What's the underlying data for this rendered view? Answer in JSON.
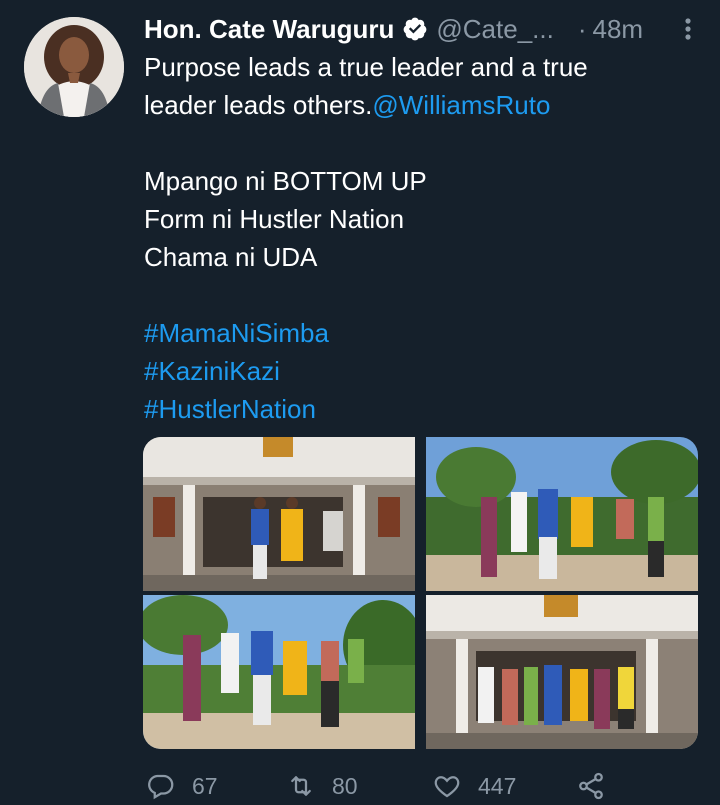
{
  "tweet": {
    "author_name": "Hon. Cate Waruguru",
    "handle": "@Cate_...",
    "separator": "·",
    "time": "48m",
    "lines": [
      {
        "text": "Purpose leads a true leader and a true"
      },
      {
        "text": "leader leads others.",
        "mention": "@WilliamsRuto"
      },
      {
        "text": ""
      },
      {
        "text": "Mpango ni BOTTOM UP"
      },
      {
        "text": "Form ni Hustler Nation"
      },
      {
        "text": "Chama ni UDA"
      },
      {
        "text": ""
      }
    ],
    "hashtags": [
      "#MamaNiSimba",
      "#KaziniKazi",
      "#HustlerNation"
    ]
  },
  "actions": {
    "replies": "67",
    "retweets": "80",
    "likes": "447"
  },
  "icons": {
    "verified": "verified-badge-icon",
    "more": "more-options-icon",
    "reply": "reply-icon",
    "retweet": "retweet-icon",
    "like": "heart-icon",
    "share": "share-icon"
  },
  "colors": {
    "background": "#15202b",
    "link": "#1d9bf0",
    "muted": "#8b98a5"
  }
}
